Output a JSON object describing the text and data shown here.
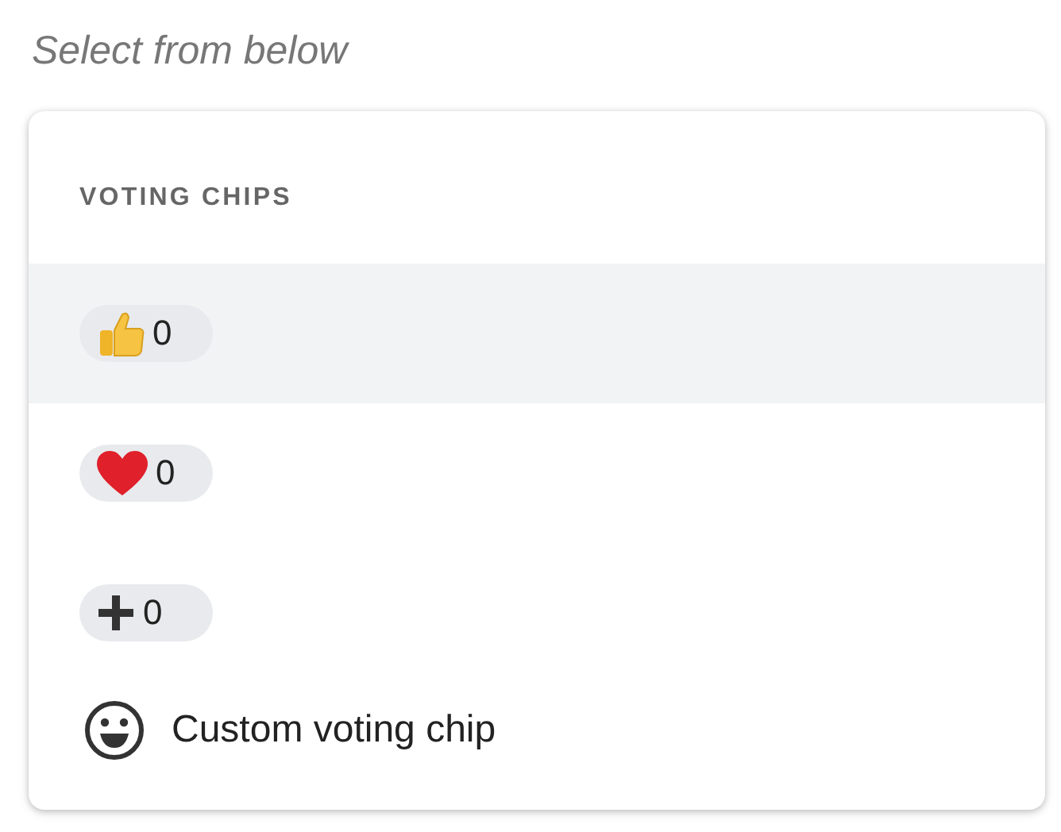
{
  "prompt": "Select from below",
  "menu": {
    "header": "VOTING CHIPS",
    "chips": [
      {
        "kind": "thumbs",
        "count": "0",
        "selected": true
      },
      {
        "kind": "heart",
        "count": "0",
        "selected": false
      },
      {
        "kind": "plus",
        "count": "0",
        "selected": false
      }
    ],
    "custom": {
      "label": "Custom voting chip"
    }
  }
}
